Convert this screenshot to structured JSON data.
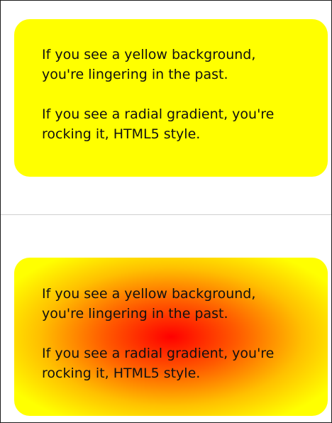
{
  "cards": [
    {
      "variant": "yellow-background",
      "line1": "If you see a yellow background, you're lingering in the past.",
      "line2": "If you see a radial gradient, you're rocking it, HTML5 style."
    },
    {
      "variant": "radial-gradient",
      "line1": "If you see a yellow background, you're lingering in the past.",
      "line2": "If you see a radial gradient, you're rocking it, HTML5 style."
    }
  ],
  "colors": {
    "yellow": "#ffff00",
    "gradient_center": "#ff0000",
    "gradient_edge": "#ffff00",
    "text": "#111111",
    "divider": "#cfcfcf"
  }
}
